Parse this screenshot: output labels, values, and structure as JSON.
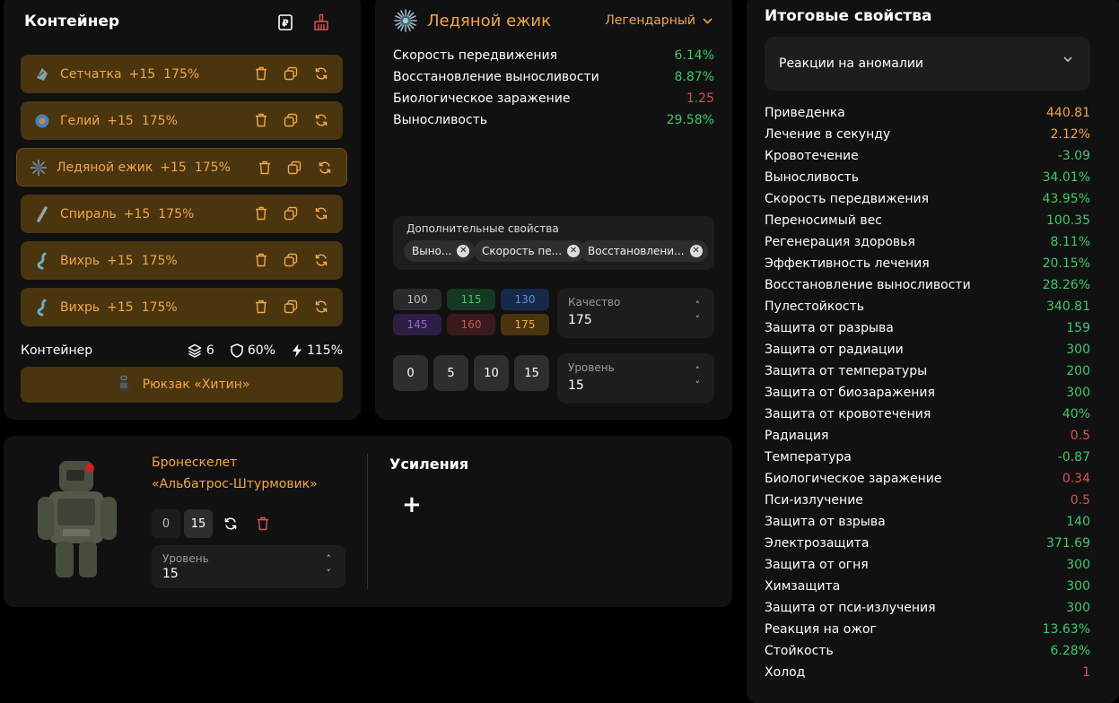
{
  "container": {
    "title": "Контейнер",
    "slots": [
      {
        "name": "Сетчатка",
        "level": "+15",
        "quality": "175%",
        "art_color": "#8a9aa8"
      },
      {
        "name": "Гелий",
        "level": "+15",
        "quality": "175%",
        "art_color": "#4a7fc8"
      },
      {
        "name": "Ледяной ежик",
        "level": "+15",
        "quality": "175%",
        "art_color": "#7f9ab0"
      },
      {
        "name": "Спираль",
        "level": "+15",
        "quality": "175%",
        "art_color": "#9aa0a8"
      },
      {
        "name": "Вихрь",
        "level": "+15",
        "quality": "175%",
        "art_color": "#6ab0c8"
      },
      {
        "name": "Вихрь",
        "level": "+15",
        "quality": "175%",
        "art_color": "#6ab0c8"
      }
    ],
    "footer_label": "Контейнер",
    "capacity": "6",
    "protection": "60%",
    "efficiency": "115%",
    "backpack": "Рюкзак «Хитин»"
  },
  "artifact": {
    "name": "Ледяной ежик",
    "rarity": "Легендарный",
    "stats": [
      {
        "label": "Скорость передвижения",
        "value": "6.14%",
        "color": "green"
      },
      {
        "label": "Восстановление выносливости",
        "value": "8.87%",
        "color": "green"
      },
      {
        "label": "Биологическое заражение",
        "value": "1.25",
        "color": "red"
      },
      {
        "label": "Выносливость",
        "value": "29.58%",
        "color": "green"
      }
    ],
    "extra_label": "Дополнительные свойства",
    "extra_chips": [
      "Выно...",
      "Скорость пе...",
      "Восстановлени..."
    ],
    "quality_buttons": [
      {
        "label": "100",
        "bg": "#2a2a2d",
        "fg": "#bbbbbb"
      },
      {
        "label": "115",
        "bg": "#143820",
        "fg": "#45c46a"
      },
      {
        "label": "130",
        "bg": "#152a48",
        "fg": "#5b8fd8"
      },
      {
        "label": "145",
        "bg": "#2e1d44",
        "fg": "#9a6ad0"
      },
      {
        "label": "160",
        "bg": "#3a1a1c",
        "fg": "#c8585a"
      },
      {
        "label": "175",
        "bg": "#4a350f",
        "fg": "#f2a64a"
      }
    ],
    "quality_label": "Качество",
    "quality_value": "175",
    "level_buttons": [
      "0",
      "5",
      "10",
      "15"
    ],
    "level_label": "Уровень",
    "level_value": "15"
  },
  "armor": {
    "name_line1": "Бронескелет",
    "name_line2": "«Альбатрос-Штурмовик»",
    "btn0": "0",
    "btn15": "15",
    "level_label": "Уровень",
    "level_value": "15",
    "boosts_title": "Усиления",
    "add": "+"
  },
  "totals": {
    "title": "Итоговые свойства",
    "dropdown": "Реакции на аномалии",
    "rows": [
      {
        "label": "Приведенка",
        "value": "440.81",
        "color": "orange"
      },
      {
        "label": "Лечение в секунду",
        "value": "2.12%",
        "color": "orange"
      },
      {
        "label": "Кровотечение",
        "value": "-3.09",
        "color": "green"
      },
      {
        "label": "Выносливость",
        "value": "34.01%",
        "color": "green"
      },
      {
        "label": "Скорость передвижения",
        "value": "43.95%",
        "color": "green"
      },
      {
        "label": "Переносимый вес",
        "value": "100.35",
        "color": "green"
      },
      {
        "label": "Регенерация здоровья",
        "value": "8.11%",
        "color": "green"
      },
      {
        "label": "Эффективность лечения",
        "value": "20.15%",
        "color": "green"
      },
      {
        "label": "Восстановление выносливости",
        "value": "28.26%",
        "color": "green"
      },
      {
        "label": "Пулестойкость",
        "value": "340.81",
        "color": "green"
      },
      {
        "label": "Защита от разрыва",
        "value": "159",
        "color": "green"
      },
      {
        "label": "Защита от радиации",
        "value": "300",
        "color": "green"
      },
      {
        "label": "Защита от температуры",
        "value": "200",
        "color": "green"
      },
      {
        "label": "Защита от биозаражения",
        "value": "300",
        "color": "green"
      },
      {
        "label": "Защита от кровотечения",
        "value": "40%",
        "color": "green"
      },
      {
        "label": "Радиация",
        "value": "0.5",
        "color": "red"
      },
      {
        "label": "Температура",
        "value": "-0.87",
        "color": "green"
      },
      {
        "label": "Биологическое заражение",
        "value": "0.34",
        "color": "red"
      },
      {
        "label": "Пси-излучение",
        "value": "0.5",
        "color": "red"
      },
      {
        "label": "Защита от взрыва",
        "value": "140",
        "color": "green"
      },
      {
        "label": "Электрозащита",
        "value": "371.69",
        "color": "green"
      },
      {
        "label": "Защита от огня",
        "value": "300",
        "color": "green"
      },
      {
        "label": "Химзащита",
        "value": "300",
        "color": "green"
      },
      {
        "label": "Защита от пси-излучения",
        "value": "300",
        "color": "green"
      },
      {
        "label": "Реакция на ожог",
        "value": "13.63%",
        "color": "green"
      },
      {
        "label": "Стойкость",
        "value": "6.28%",
        "color": "green"
      },
      {
        "label": "Холод",
        "value": "1",
        "color": "red"
      }
    ]
  },
  "colors": {
    "accent": "#f2a64a",
    "slot_bg": "#4a350f",
    "green": "#3ecb6a",
    "red": "#d9534f",
    "panel": "#111112"
  }
}
